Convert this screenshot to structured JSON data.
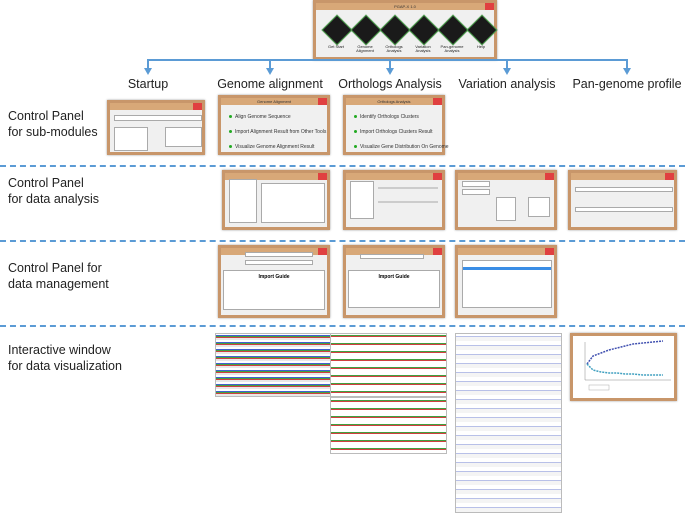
{
  "main_window": {
    "title": "PGAP-X 1.0",
    "buttons": [
      {
        "label": "Get Start",
        "letter": "S"
      },
      {
        "label": "Genome Alignment",
        "letter": "A"
      },
      {
        "label": "Orthologs Analysis",
        "letter": "O"
      },
      {
        "label": "Variation Analysis",
        "letter": "V"
      },
      {
        "label": "Pan-genome Analysis",
        "letter": "P"
      },
      {
        "label": "Help",
        "letter": ""
      }
    ]
  },
  "columns": [
    "Startup",
    "Genome alignment",
    "Orthologs Analysis",
    "Variation analysis",
    "Pan-genome profile"
  ],
  "rows": [
    {
      "line1": "Control Panel",
      "line2": "for sub-modules"
    },
    {
      "line1": "Control Panel",
      "line2": "for data analysis"
    },
    {
      "line1": "Control Panel for",
      "line2": "data management"
    },
    {
      "line1": "Interactive window",
      "line2": "for data visualization"
    }
  ],
  "panels": {
    "genome_alignment": {
      "title": "Genome Alignment",
      "items": [
        "Align Genome Sequence",
        "Import Alignment Result from Other Tools",
        "Visualize Genome Alignment Result"
      ]
    },
    "orthologs_analysis": {
      "title": "Orthologs Analysis",
      "items": [
        "Identify Orthologs Clusters",
        "Import Orthologs Clusters Result",
        "Visualize Gene Distribution On Genome"
      ]
    },
    "import_guide_ga": "Import Guide",
    "import_guide_oa": "Import Guide"
  },
  "accent_color": "#5b9bd5",
  "window_border_color": "#c8966a"
}
